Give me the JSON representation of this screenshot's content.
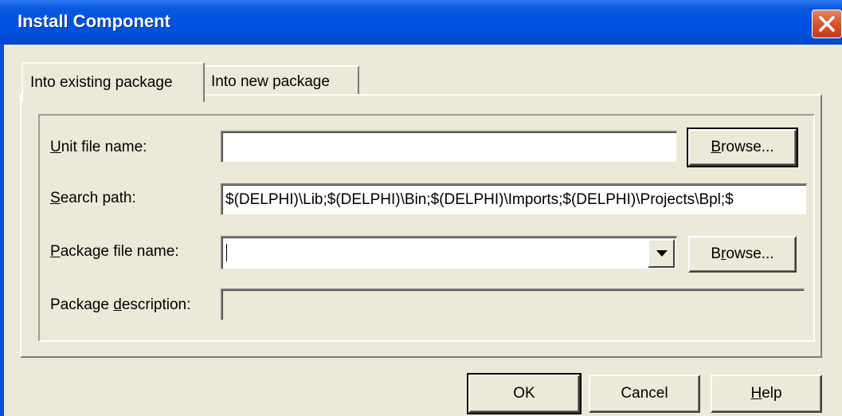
{
  "window": {
    "title": "Install Component"
  },
  "tabs": [
    {
      "label": "Into existing package",
      "active": true
    },
    {
      "label": "Into new package",
      "active": false
    }
  ],
  "form": {
    "unit_file": {
      "label_u": "U",
      "label_rest": "nit file name:",
      "value": "",
      "browse_u": "B",
      "browse_rest": "rowse..."
    },
    "search_path": {
      "label_u": "S",
      "label_rest": "earch path:",
      "value": "$(DELPHI)\\Lib;$(DELPHI)\\Bin;$(DELPHI)\\Imports;$(DELPHI)\\Projects\\Bpl;$"
    },
    "package_file": {
      "label_u": "P",
      "label_rest": "ackage file name:",
      "value": "",
      "browse_pre": "B",
      "browse_u": "r",
      "browse_rest": "owse..."
    },
    "package_desc": {
      "label_pre": "Package ",
      "label_u": "d",
      "label_rest": "escription:",
      "value": ""
    }
  },
  "buttons": {
    "ok": "OK",
    "cancel": "Cancel",
    "help_u": "H",
    "help_rest": "elp"
  },
  "colors": {
    "face": "#ece9d8",
    "titlebar": "#0053e1",
    "close": "#d5552e"
  },
  "icons": {
    "close": "close-icon",
    "dropdown": "chevron-down-icon"
  }
}
